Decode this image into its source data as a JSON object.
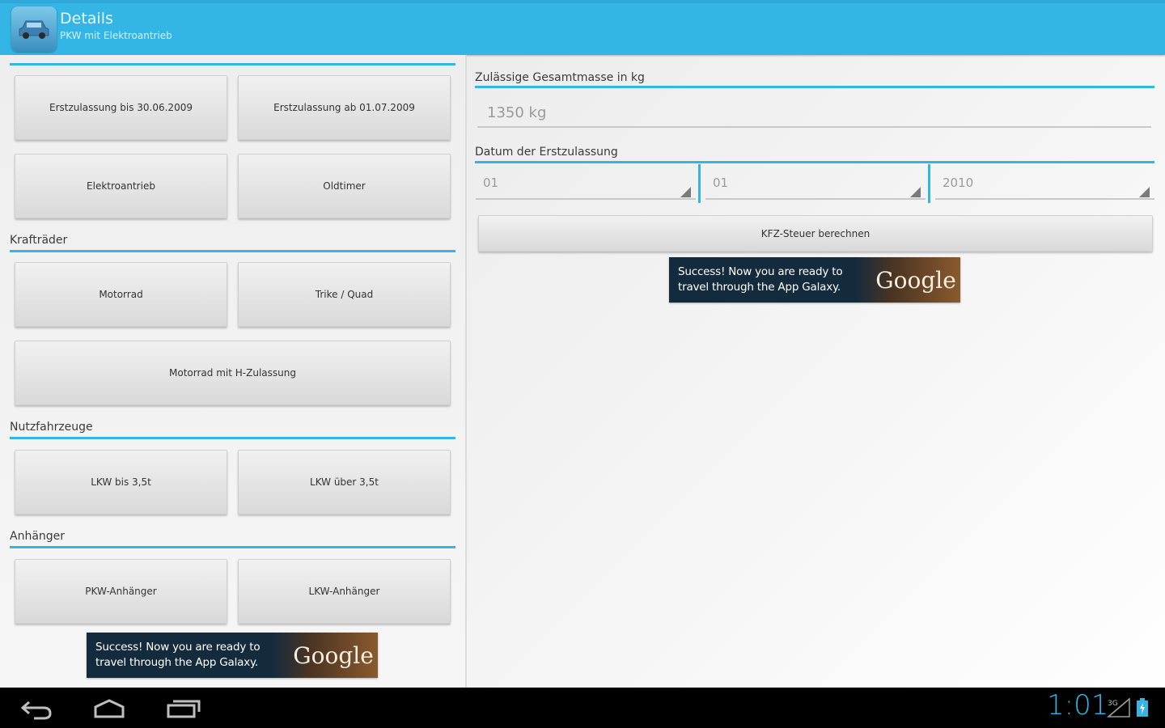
{
  "action_bar": {
    "title": "Details",
    "subtitle": "PKW mit Elektroantrieb",
    "accent_color": "#33b5e5",
    "app_icon": "car-icon"
  },
  "left_panel": {
    "pkw_buttons": [
      "Erstzulassung bis 30.06.2009",
      "Erstzulassung ab 01.07.2009",
      "Elektroantrieb",
      "Oldtimer"
    ],
    "motorcycles": {
      "header": "Krafträder",
      "buttons": [
        "Motorrad",
        "Trike / Quad",
        "Motorrad mit H-Zulassung"
      ]
    },
    "commercial": {
      "header": "Nutzfahrzeuge",
      "buttons": [
        "LKW bis 3,5t",
        "LKW über 3,5t"
      ]
    },
    "trailers": {
      "header": "Anhänger",
      "buttons": [
        "PKW-Anhänger",
        "LKW-Anhänger"
      ]
    }
  },
  "form": {
    "mass_label": "Zulässige Gesamtmasse in kg",
    "mass_value": "1350 kg",
    "date_label": "Datum der Erstzulassung",
    "day": "01",
    "month": "01",
    "year": "2010",
    "calculate_button": "KFZ-Steuer berechnen"
  },
  "ad": {
    "text": "Success! Now you are ready to travel through the App Galaxy.",
    "logo": "Google"
  },
  "status_bar": {
    "time": "1:01",
    "signal_label": "3G"
  },
  "nav_icons": [
    "back-icon",
    "home-icon",
    "recent-apps-icon"
  ]
}
